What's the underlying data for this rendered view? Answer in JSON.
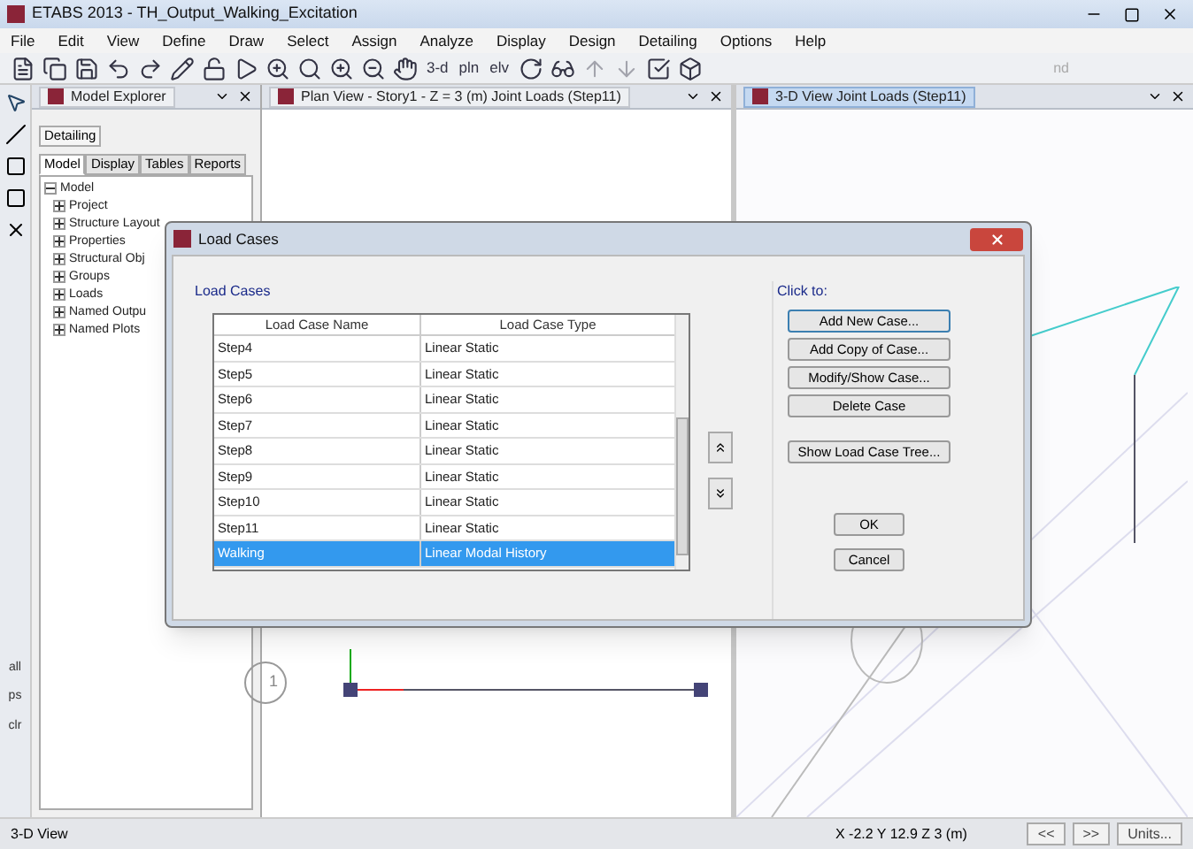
{
  "window": {
    "title": "ETABS 2013  - TH_Output_Walking_Excitation"
  },
  "menu": [
    "File",
    "Edit",
    "View",
    "Define",
    "Draw",
    "Select",
    "Assign",
    "Analyze",
    "Display",
    "Design",
    "Detailing",
    "Options",
    "Help"
  ],
  "toolbar_texts": [
    "3-d",
    "pln",
    "elv",
    "nd"
  ],
  "side_tools": [
    "all",
    "ps",
    "clr"
  ],
  "explorer": {
    "title": "Model Explorer",
    "upper_tab": "Detailing",
    "tabs": [
      {
        "label": "Model",
        "selected": true
      },
      {
        "label": "Display",
        "selected": false
      },
      {
        "label": "Tables",
        "selected": false
      },
      {
        "label": "Reports",
        "selected": false
      }
    ],
    "tree": [
      {
        "label": "Model",
        "expanded": true,
        "children": [
          {
            "label": "Project",
            "expanded": false
          },
          {
            "label": "Structure Layout",
            "expanded": false
          },
          {
            "label": "Properties",
            "expanded": false
          },
          {
            "label": "Structural Obj",
            "expanded": false
          },
          {
            "label": "Groups",
            "expanded": false
          },
          {
            "label": "Loads",
            "expanded": false
          },
          {
            "label": "Named Outpu",
            "expanded": false
          },
          {
            "label": "Named Plots",
            "expanded": false
          }
        ]
      }
    ]
  },
  "plan_view": {
    "title": "Plan View - Story1 - Z = 3 (m)  Joint Loads (Step11)",
    "grid_label": "1",
    "selected": false
  },
  "view_3d": {
    "title": "3-D View  Joint Loads (Step11)",
    "selected": true
  },
  "dialog": {
    "title": "Load Cases",
    "group_label": "Load Cases",
    "columns": [
      "Load Case Name",
      "Load Case Type"
    ],
    "rows": [
      {
        "name": "Step4",
        "type": "Linear Static",
        "selected": false
      },
      {
        "name": "Step5",
        "type": "Linear Static",
        "selected": false
      },
      {
        "name": "Step6",
        "type": "Linear Static",
        "selected": false
      },
      {
        "name": "Step7",
        "type": "Linear Static",
        "selected": false
      },
      {
        "name": "Step8",
        "type": "Linear Static",
        "selected": false
      },
      {
        "name": "Step9",
        "type": "Linear Static",
        "selected": false
      },
      {
        "name": "Step10",
        "type": "Linear Static",
        "selected": false
      },
      {
        "name": "Step11",
        "type": "Linear Static",
        "selected": false
      },
      {
        "name": "Walking",
        "type": "Linear Modal History",
        "selected": true
      }
    ],
    "click_to_label": "Click to:",
    "actions": [
      "Add New Case...",
      "Add Copy of Case...",
      "Modify/Show Case...",
      "Delete Case"
    ],
    "tree_action": "Show Load Case Tree...",
    "ok": "OK",
    "cancel": "Cancel"
  },
  "status_bar": {
    "view": "3-D View",
    "coordinates": "X -2.2  Y 12.9  Z 3 (m)",
    "buttons": [
      "<<",
      ">>",
      "Units..."
    ]
  }
}
